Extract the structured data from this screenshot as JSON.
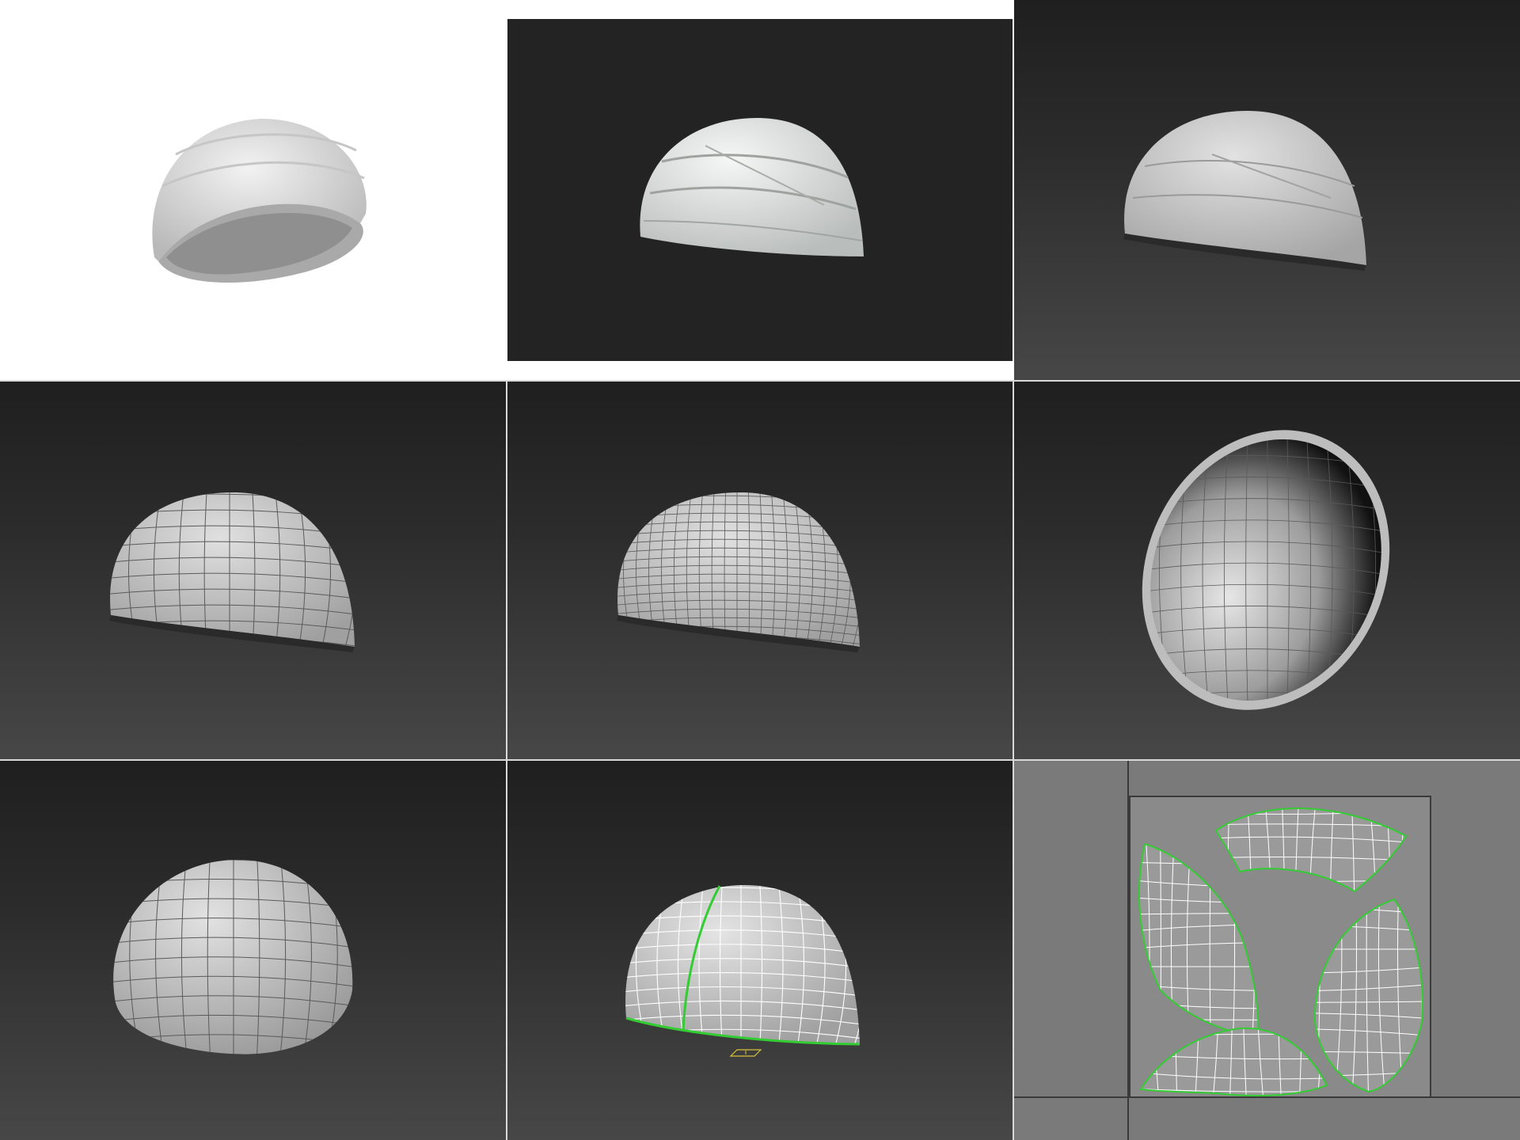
{
  "grid": {
    "rows": 3,
    "cols": 3,
    "panels": [
      {
        "name": "white-background-render",
        "kind": "render",
        "mesh": "smooth-with-bandage-wraps",
        "view": "tilted-showing-interior"
      },
      {
        "name": "dark-render",
        "kind": "render",
        "mesh": "smooth-with-bandage-wraps",
        "view": "front"
      },
      {
        "name": "viewport-shaded",
        "kind": "viewport",
        "mesh": "smooth-with-bandage-wraps",
        "view": "front"
      },
      {
        "name": "viewport-wireframe-low",
        "kind": "viewport",
        "mesh": "wireframe-low-density",
        "view": "front"
      },
      {
        "name": "viewport-wireframe-high",
        "kind": "viewport",
        "mesh": "wireframe-high-density",
        "view": "front"
      },
      {
        "name": "viewport-interior",
        "kind": "viewport",
        "mesh": "wireframe-interior",
        "view": "inside-looking-up"
      },
      {
        "name": "viewport-tilted-wireframe",
        "kind": "viewport",
        "mesh": "wireframe-low-density",
        "view": "tilted"
      },
      {
        "name": "viewport-uv-seams",
        "kind": "viewport",
        "mesh": "wireframe-with-seam",
        "view": "front",
        "seam_color": "#33cc33"
      },
      {
        "name": "uv-editor",
        "kind": "uv-layout",
        "islands": 4,
        "island_edge_color": "#33cc33"
      }
    ]
  },
  "colors": {
    "viewport_top": "#1f1f1f",
    "viewport_bottom": "#474747",
    "render_bg": "#232323",
    "mesh_fill": "#d4d4d4",
    "wire": "#555555",
    "seam": "#33cc33",
    "uv_bg": "#7a7a7a",
    "separator": "#d9d9d9"
  },
  "icons": [
    "pivot-gizmo-icon"
  ]
}
